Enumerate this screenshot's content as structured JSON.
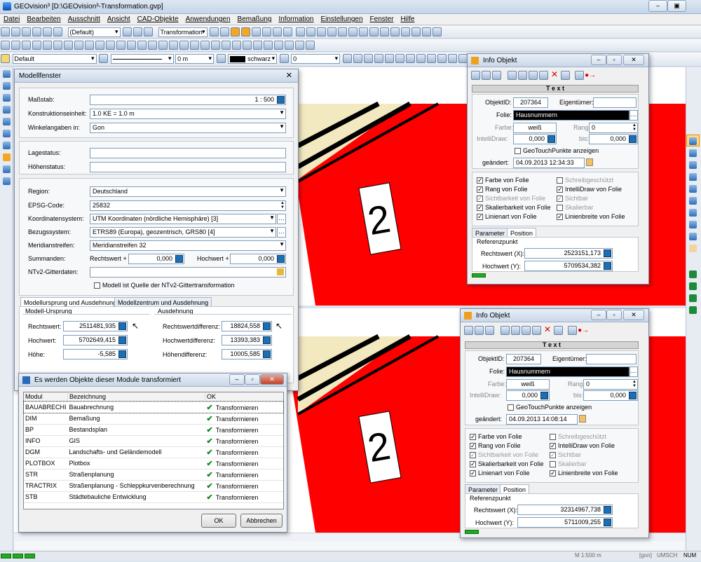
{
  "app": {
    "title": "GEOvision³  [D:\\GEOvision³-Transformation.gvp]"
  },
  "menu": [
    "Datei",
    "Bearbeiten",
    "Ausschnitt",
    "Ansicht",
    "CAD-Objekte",
    "Anwendungen",
    "Bemaßung",
    "Information",
    "Einstellungen",
    "Fenster",
    "Hilfe"
  ],
  "toolbar": {
    "view_combo": "(Default)",
    "transform_combo": "Transformation",
    "layer_combo": "Default",
    "length_value": "0 m",
    "color_combo": "schwarz",
    "num_value": "0"
  },
  "drawing": {
    "label_top": "2",
    "label_bottom": "2"
  },
  "modell": {
    "title": "Modellfenster",
    "massstab_label": "Maßstab:",
    "massstab_value": "1 : 500",
    "konstruktion_label": "Konstruktionseinheit:",
    "konstruktion_value": "1.0 KE  =  1.0 m",
    "winkel_label": "Winkelangaben in:",
    "winkel_value": "Gon",
    "lagestatus_label": "Lagestatus:",
    "hoehenstatus_label": "Höhenstatus:",
    "region_label": "Region:",
    "region_value": "Deutschland",
    "epsg_label": "EPSG-Code:",
    "epsg_value": "25832",
    "koord_label": "Koordinatensystem:",
    "koord_value": "UTM Koordinaten (nördliche Hemisphäre) [3]",
    "bezug_label": "Bezugssystem:",
    "bezug_value": "ETRS89 (Europa), geozentrisch, GRS80 [4]",
    "meridian_label": "Meridianstreifen:",
    "meridian_value": "Meridianstreifen 32",
    "summanden_label": "Summanden:",
    "rechtswert_label": "Rechtswert +",
    "rechtswert_value": "0,000",
    "hochwert_label": "Hochwert +",
    "hochwert_value": "0,000",
    "ntv2_label": "NTv2-Gitterdaten:",
    "ntv2_check": "Modell ist Quelle der NTv2-Gittertransformation",
    "tab1": "Modellursprung und Ausdehnung",
    "tab2": "Modellzentrum und Ausdehnung",
    "ursprung_title": "Modell-Ursprung",
    "ausdehnung_title": "Ausdehnung",
    "u_rechtswert_label": "Rechtswert:",
    "u_rechtswert": "2511481,935",
    "u_hochwert_label": "Hochwert:",
    "u_hochwert": "5702649,415",
    "u_hoehe_label": "Höhe:",
    "u_hoehe": "-5,585",
    "a_rw_label": "Rechtswertdifferenz:",
    "a_rw": "18824,558",
    "a_hw_label": "Hochwertdifferenz:",
    "a_hw": "13393,383",
    "a_h_label": "Höhendifferenz:",
    "a_h": "10005,585"
  },
  "modules": {
    "title": "Es werden Objekte dieser Module transformiert",
    "col_modul": "Modul",
    "col_bez": "Bezeichnung",
    "col_ok": "OK",
    "rows": [
      {
        "modul": "BAUABRECHI",
        "bez": "Bauabrechnung",
        "ok": "Transformieren"
      },
      {
        "modul": "DIM",
        "bez": "Bemaßung",
        "ok": "Transformieren"
      },
      {
        "modul": "BP",
        "bez": "Bestandsplan",
        "ok": "Transformieren"
      },
      {
        "modul": "INFO",
        "bez": "GIS",
        "ok": "Transformieren"
      },
      {
        "modul": "DGM",
        "bez": "Landschafts- und Geländemodell",
        "ok": "Transformieren"
      },
      {
        "modul": "PLOTBOX",
        "bez": "Plotbox",
        "ok": "Transformieren"
      },
      {
        "modul": "STR",
        "bez": "Straßenplanung",
        "ok": "Transformieren"
      },
      {
        "modul": "TRACTRIX",
        "bez": "Straßenplanung - Schleppkurvenberechnung",
        "ok": "Transformieren"
      },
      {
        "modul": "STB",
        "bez": "Städtebauliche Entwicklung",
        "ok": "Transformieren"
      }
    ],
    "ok_button": "OK",
    "cancel_button": "Abbrechen"
  },
  "info1": {
    "title": "Info Objekt",
    "header": "T e x t",
    "objektid_label": "ObjektID:",
    "objektid": "207364",
    "eigentuemer_label": "Eigentümer:",
    "folie_label": "Folie:",
    "folie": "Hausnummern",
    "farbe_label": "Farbe:",
    "farbe": "weiß",
    "rang_label": "Rang:",
    "rang": "0",
    "intelli_label": "IntelliDraw:",
    "intelli": "0,000",
    "bis_label": "bis:",
    "bis": "0,000",
    "geotouch": "GeoTouchPunkte anzeigen",
    "geaendert_label": "geändert:",
    "geaendert": "04.09.2013 12:34:33",
    "checks_left": [
      "Farbe von Folie",
      "Rang von Folie",
      "Sichtbarkeit von Folie",
      "Skalierbarkeit von Folie",
      "Linienart von Folie"
    ],
    "checks_right": [
      "Schreibgeschützt",
      "IntelliDraw von Folie",
      "Sichtbar",
      "Skalierbar",
      "Linienbreite von Folie"
    ],
    "tab_param": "Parameter",
    "tab_pos": "Position",
    "ref_title": "Referenzpunkt",
    "rw_label": "Rechtswert (X):",
    "rw": "2523151,173",
    "hw_label": "Hochwert (Y):",
    "hw": "5709534,382"
  },
  "info2": {
    "title": "Info Objekt",
    "header": "T e x t",
    "objektid_label": "ObjektID:",
    "objektid": "207364",
    "eigentuemer_label": "Eigentümer:",
    "folie_label": "Folie:",
    "folie": "Hausnummern",
    "farbe_label": "Farbe:",
    "farbe": "weiß",
    "rang_label": "Rang:",
    "rang": "0",
    "intelli_label": "IntelliDraw:",
    "intelli": "0,000",
    "bis_label": "bis:",
    "bis": "0,000",
    "geotouch": "GeoTouchPunkte anzeigen",
    "geaendert_label": "geändert:",
    "geaendert": "04.09.2013 14:08:14",
    "checks_left": [
      "Farbe von Folie",
      "Rang von Folie",
      "Sichtbarkeit von Folie",
      "Skalierbarkeit von Folie",
      "Linienart von Folie"
    ],
    "checks_right": [
      "Schreibgeschützt",
      "IntelliDraw von Folie",
      "Sichtbar",
      "Skalierbar",
      "Linienbreite von Folie"
    ],
    "tab_param": "Parameter",
    "tab_pos": "Position",
    "ref_title": "Referenzpunkt",
    "rw_label": "Rechtswert (X):",
    "rw": "32314967,738",
    "hw_label": "Hochwert (Y):",
    "hw": "5711009,255"
  },
  "status": {
    "scale": "M 1:500  m",
    "angle": "[gon]",
    "umsch": "UMSCH",
    "num": "NUM"
  },
  "colors": {
    "red": "#ff0000",
    "cream": "#f3e9c0",
    "accent": "#1d6fb5"
  }
}
